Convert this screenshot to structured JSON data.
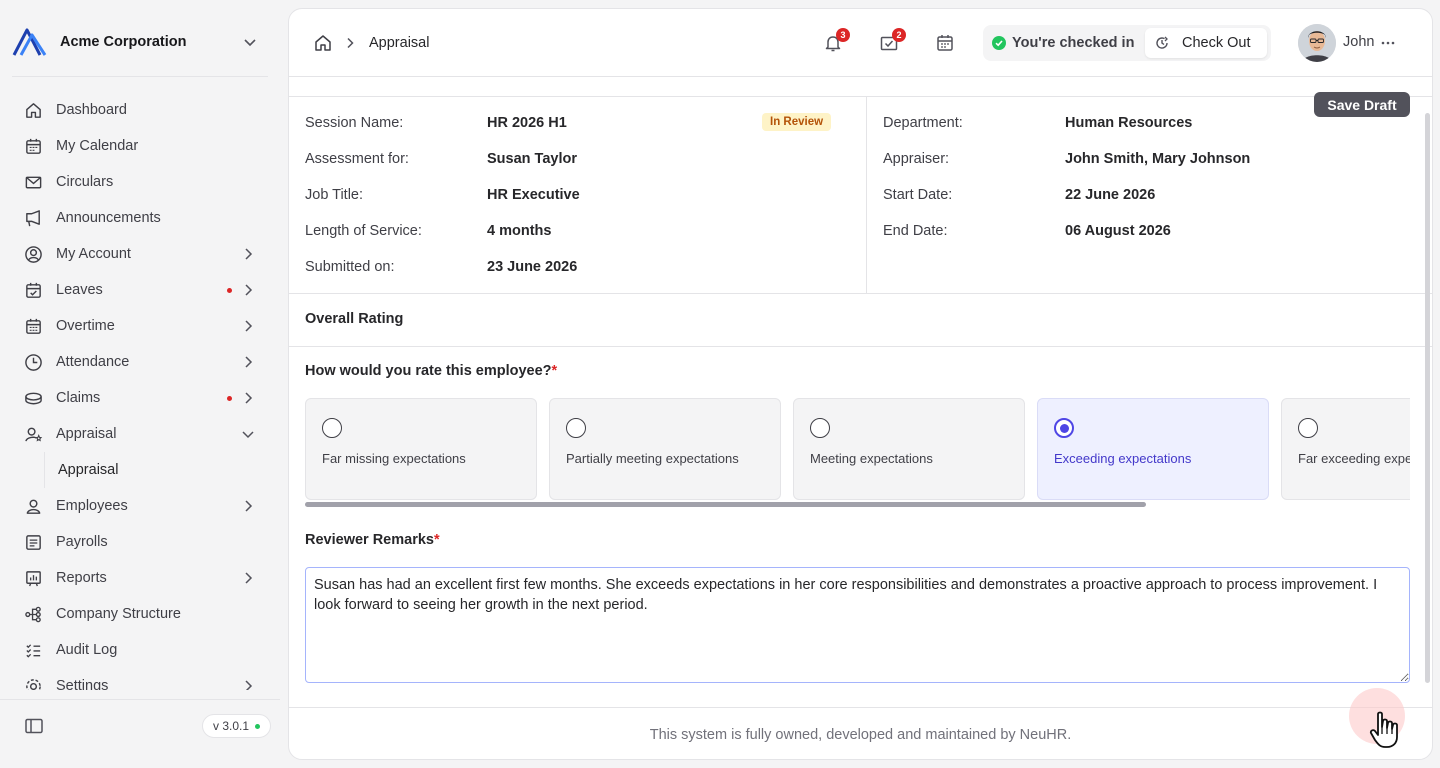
{
  "org": {
    "name": "Acme Corporation"
  },
  "nav": {
    "items": [
      {
        "label": "Dashboard"
      },
      {
        "label": "My Calendar"
      },
      {
        "label": "Circulars"
      },
      {
        "label": "Announcements"
      },
      {
        "label": "My Account"
      },
      {
        "label": "Leaves"
      },
      {
        "label": "Overtime"
      },
      {
        "label": "Attendance"
      },
      {
        "label": "Claims"
      },
      {
        "label": "Appraisal"
      },
      {
        "label": "Appraisal"
      },
      {
        "label": "Employees"
      },
      {
        "label": "Payrolls"
      },
      {
        "label": "Reports"
      },
      {
        "label": "Company Structure"
      },
      {
        "label": "Audit Log"
      },
      {
        "label": "Settings"
      }
    ]
  },
  "version": "v 3.0.1",
  "breadcrumb": {
    "current": "Appraisal"
  },
  "topbar": {
    "notifications_count": "3",
    "tasks_count": "2",
    "checkin_status": "You're checked in",
    "checkout_label": "Check Out",
    "user_name": "John"
  },
  "actions": {
    "save_draft": "Save Draft"
  },
  "session": {
    "status": "In Review",
    "left": [
      {
        "label": "Session Name:",
        "value": "HR 2026 H1"
      },
      {
        "label": "Assessment for:",
        "value": "Susan Taylor"
      },
      {
        "label": "Job Title:",
        "value": "HR Executive"
      },
      {
        "label": "Length of Service:",
        "value": "4 months"
      },
      {
        "label": "Submitted on:",
        "value": "23 June 2026"
      }
    ],
    "right": [
      {
        "label": "Department:",
        "value": "Human Resources"
      },
      {
        "label": "Appraiser:",
        "value": "John Smith, Mary Johnson"
      },
      {
        "label": "Start Date:",
        "value": "22 June 2026"
      },
      {
        "label": "End Date:",
        "value": "06 August 2026"
      }
    ]
  },
  "rating": {
    "section_title": "Overall Rating",
    "question": "How would you rate this employee?",
    "required_mark": "*",
    "options": [
      "Far missing expectations",
      "Partially meeting expectations",
      "Meeting expectations",
      "Exceeding expectations",
      "Far exceeding expectations"
    ],
    "selected": "Exceeding expectations"
  },
  "remarks": {
    "label": "Reviewer Remarks",
    "required_mark": "*",
    "value": "Susan has had an excellent first few months. She exceeds expectations in her core responsibilities and demonstrates a proactive approach to process improvement. I look forward to seeing her growth in the next period."
  },
  "footer": {
    "text": "This system is fully owned, developed and maintained by NeuHR."
  },
  "colors": {
    "accent": "#4f46e5",
    "alert": "#dc2626",
    "success": "#22c55e",
    "warning": "#b45309"
  }
}
